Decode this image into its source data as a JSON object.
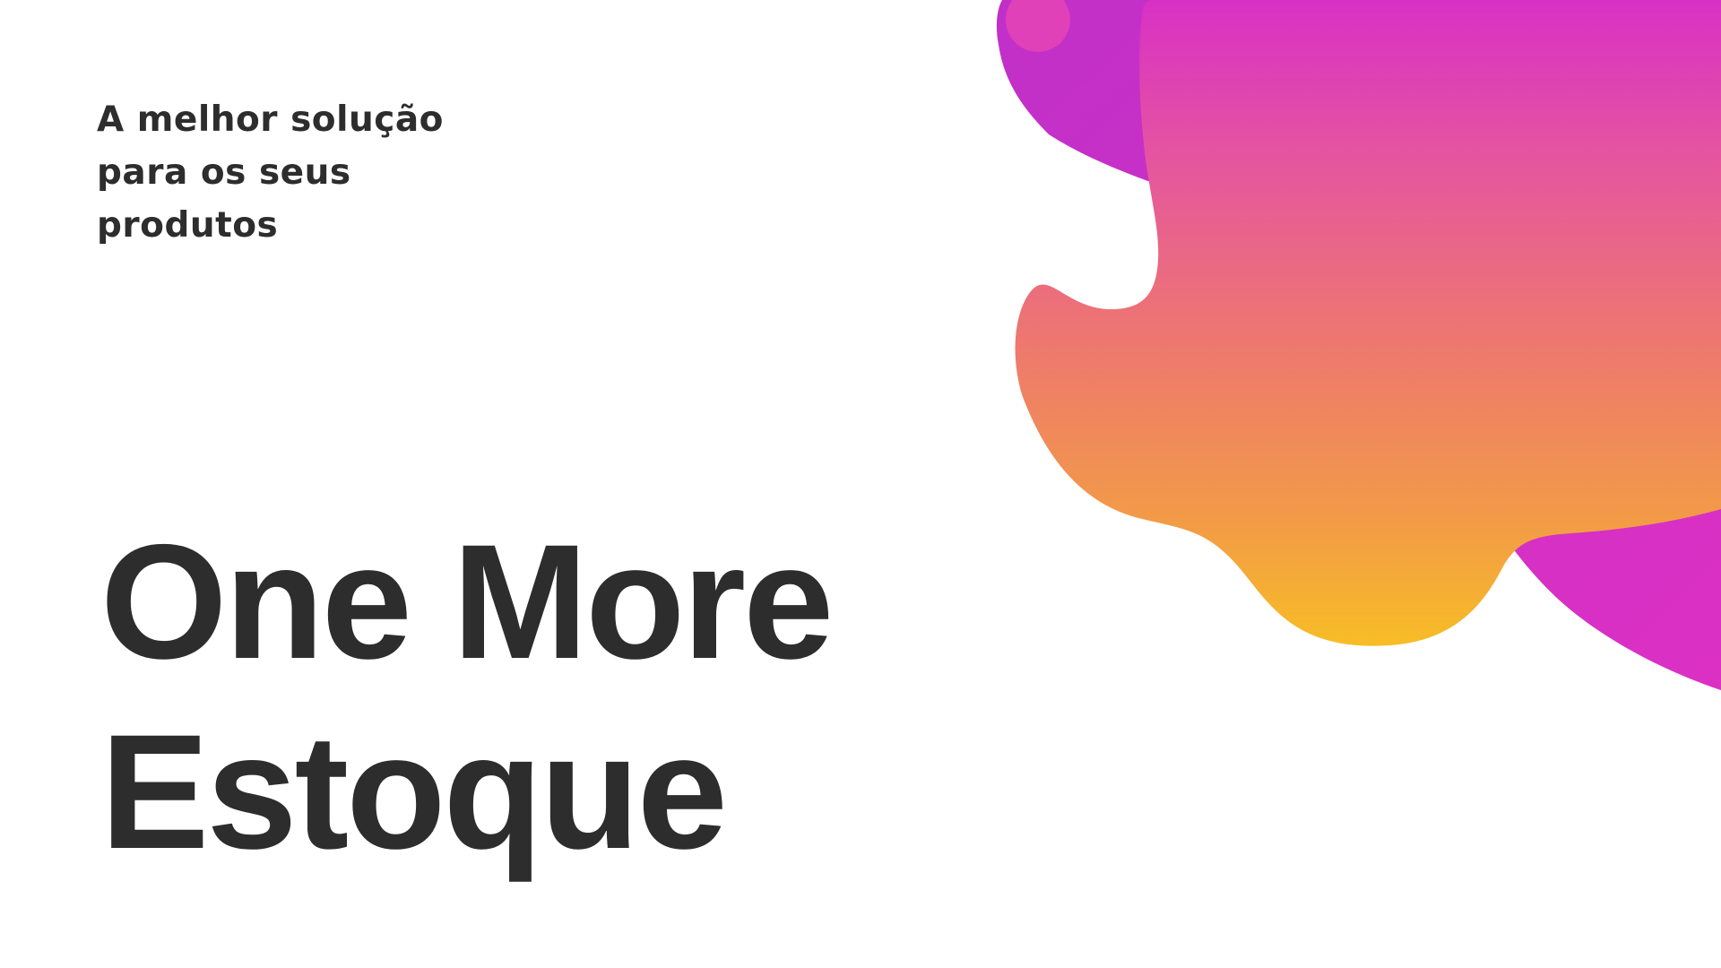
{
  "slide": {
    "tagline_lines": [
      "A melhor solução",
      "para os seus",
      "produtos"
    ],
    "title_lines": [
      "One More",
      "Estoque"
    ]
  },
  "colors": {
    "text": "#2d2d2d",
    "background": "#ffffff",
    "magenta": "#d62fc4",
    "pink": "#e55a9a",
    "orange": "#f0904e",
    "yellow": "#f7b92a"
  },
  "decoration": {
    "icon": "gradient-blob"
  }
}
